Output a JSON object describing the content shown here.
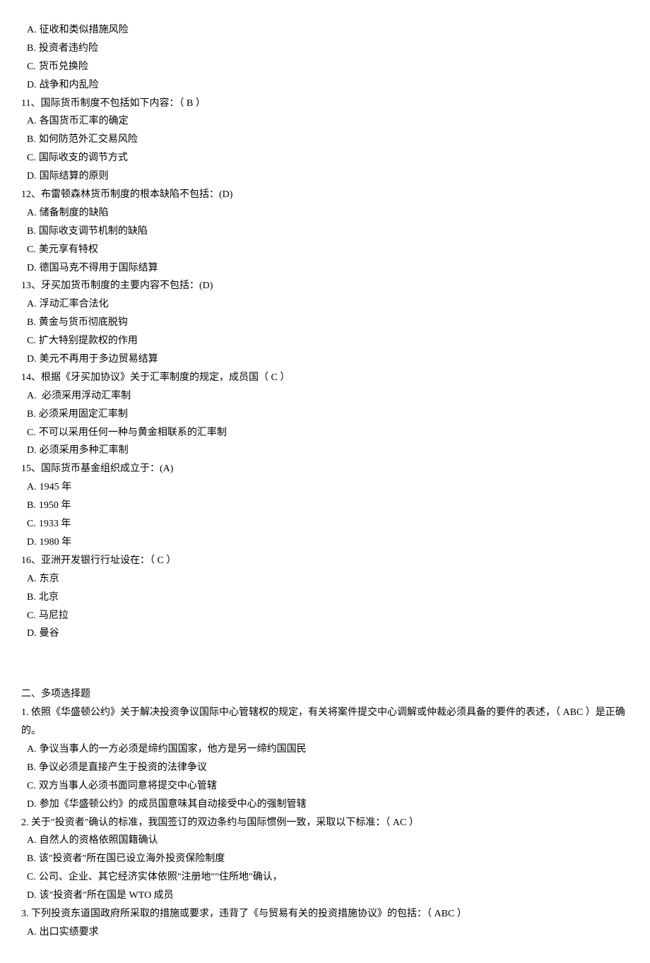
{
  "options_pre": [
    {
      "letter": "A.",
      "text": "征收和类似措施风险"
    },
    {
      "letter": "B.",
      "text": "投资者违约险"
    },
    {
      "letter": "C.",
      "text": "货币兑换险"
    },
    {
      "letter": "D.",
      "text": "战争和内乱险"
    }
  ],
  "q11": {
    "stem": "11、国际货币制度不包括如下内容：（ B ）",
    "options": [
      {
        "letter": "A.",
        "text": "各国货币汇率的确定"
      },
      {
        "letter": "B.",
        "text": "如何防范外汇交易风险"
      },
      {
        "letter": "C.",
        "text": "国际收支的调节方式"
      },
      {
        "letter": "D.",
        "text": "国际结算的原则"
      }
    ]
  },
  "q12": {
    "stem": "12、布雷顿森林货币制度的根本缺陷不包括：(D)",
    "options": [
      {
        "letter": "A.",
        "text": "储备制度的缺陷"
      },
      {
        "letter": "B.",
        "text": "国际收支调节机制的缺陷"
      },
      {
        "letter": "C.",
        "text": "美元享有特权"
      },
      {
        "letter": "D.",
        "text": "德国马克不得用于国际结算"
      }
    ]
  },
  "q13": {
    "stem": "13、牙买加货币制度的主要内容不包括：(D)",
    "options": [
      {
        "letter": "A.",
        "text": "浮动汇率合法化"
      },
      {
        "letter": "B.",
        "text": "黄金与货币彻底脱钩"
      },
      {
        "letter": "C.",
        "text": "扩大特别提款权的作用"
      },
      {
        "letter": "D.",
        "text": "美元不再用于多边贸易结算"
      }
    ]
  },
  "q14": {
    "stem": "14、根据《牙买加协议》关于汇率制度的规定，成员国（ C ）",
    "options": [
      {
        "letter": "A.",
        "text": " 必须采用浮动汇率制"
      },
      {
        "letter": "B.",
        "text": "必须采用固定汇率制"
      },
      {
        "letter": "C.",
        "text": "不可以采用任何一种与黄金相联系的汇率制"
      },
      {
        "letter": "D.",
        "text": "必须采用多种汇率制"
      }
    ]
  },
  "q15": {
    "stem": "15、国际货币基金组织成立于：(A)",
    "options": [
      {
        "letter": "A.",
        "text": "1945 年"
      },
      {
        "letter": "B.",
        "text": "1950 年"
      },
      {
        "letter": "C.",
        "text": "1933 年"
      },
      {
        "letter": "D.",
        "text": "1980 年"
      }
    ]
  },
  "q16": {
    "stem": "16、亚洲开发银行行址设在：（ C ）",
    "options": [
      {
        "letter": "A.",
        "text": "东京"
      },
      {
        "letter": "B.",
        "text": "北京"
      },
      {
        "letter": "C.",
        "text": "马尼拉"
      },
      {
        "letter": "D.",
        "text": "曼谷"
      }
    ]
  },
  "section2_title": "二、多项选择题",
  "m1": {
    "stem": "1.  依照《华盛顿公约》关于解决投资争议国际中心管辖权的规定，有关将案件提交中心调解或仲裁必须具备的要件的表述，（  ABC  ）是正确的。",
    "options": [
      {
        "letter": "A.",
        "text": "争议当事人的一方必须是缔约国国家，他方是另一缔约国国民"
      },
      {
        "letter": "B.",
        "text": "争议必须是直接产生于投资的法律争议"
      },
      {
        "letter": "C.",
        "text": "双方当事人必须书面同意将提交中心管辖"
      },
      {
        "letter": "D.",
        "text": "参加《华盛顿公约》的成员国意味其自动接受中心的强制管辖"
      }
    ]
  },
  "m2": {
    "stem": "2.  关于\"投资者\"确认的标准，我国签订的双边条约与国际惯例一致，采取以下标准：（ AC ）",
    "options": [
      {
        "letter": "A.",
        "text": "自然人的资格依照国籍确认"
      },
      {
        "letter": "B.",
        "text": "该\"投资者\"所在国已设立海外投资保险制度"
      },
      {
        "letter": "C.",
        "text": "公司、企业、其它经济实体依照\"注册地\"\"住所地\"确认，"
      },
      {
        "letter": "D.",
        "text": "该\"投资者\"所在国是 WTO 成员"
      }
    ]
  },
  "m3": {
    "stem": "3.  下列投资东道国政府所采取的措施或要求，违背了《与贸易有关的投资措施协议》的包括：（ ABC  ）",
    "options": [
      {
        "letter": "A.",
        "text": "出口实绩要求"
      }
    ]
  }
}
